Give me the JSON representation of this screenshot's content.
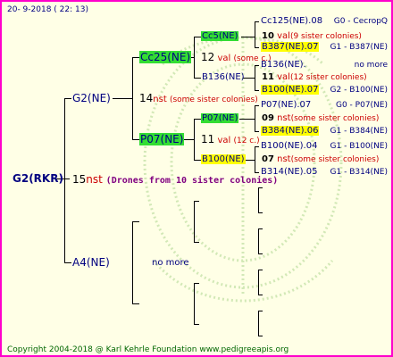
{
  "header": {
    "date": "20-  9-2018 ( 22: 13)"
  },
  "footer": {
    "copyright": "Copyright 2004-2018 @ Karl Kehrle Foundation    www.pedigreeapis.org"
  },
  "root": {
    "label": "G2(RKR)",
    "num": "15",
    "nst": "nst",
    "desc": "(Drones from 10 sister colonies)"
  },
  "gen1": {
    "top": "G2(NE)",
    "top_num": "14",
    "top_nst": "nst",
    "top_desc": "(some sister colonies)",
    "bottom": "A4(NE)",
    "bottom_desc": "no more"
  },
  "gen2": {
    "cc25": "Cc25(NE)",
    "cc25_num": "12",
    "cc25_val": "val",
    "cc25_desc": "(some c.)",
    "p07": "P07(NE)",
    "p07_num": "11",
    "p07_val": "val",
    "p07_desc": "(12 c.)"
  },
  "gen3": {
    "cc5": "Cc5(NE)",
    "cc5_num": "10",
    "cc5_val": "val",
    "cc5_desc": "(9 sister colonies)",
    "b136": "B136(NE)",
    "b136_num": "11",
    "b136_val": "val",
    "b136_desc": "(12 sister colonies)",
    "p07b": "P07(NE)",
    "p07b_num": "09",
    "p07b_nst": "nst",
    "p07b_desc": "(some sister colonies)",
    "b100": "B100(NE)",
    "b100_num": "07",
    "b100_nst": "nst",
    "b100_desc": "(some sister colonies)"
  },
  "gen4": [
    {
      "label": "Cc125(NE).08",
      "right": "G0 - CecropQ"
    },
    {
      "label": "B387(NE).07",
      "right": "G1 - B387(NE)"
    },
    {
      "label": "B136(NE).",
      "right": "no more"
    },
    {
      "label": "B100(NE).07",
      "right": "G2 - B100(NE)"
    },
    {
      "label": "P07(NE).07",
      "right": "G0 - P07(NE)"
    },
    {
      "label": "B384(NE).06",
      "right": "G1 - B384(NE)"
    },
    {
      "label": "B100(NE).04",
      "right": "G1 - B100(NE)"
    },
    {
      "label": "B314(NE).05",
      "right": "G1 - B314(NE)"
    }
  ]
}
